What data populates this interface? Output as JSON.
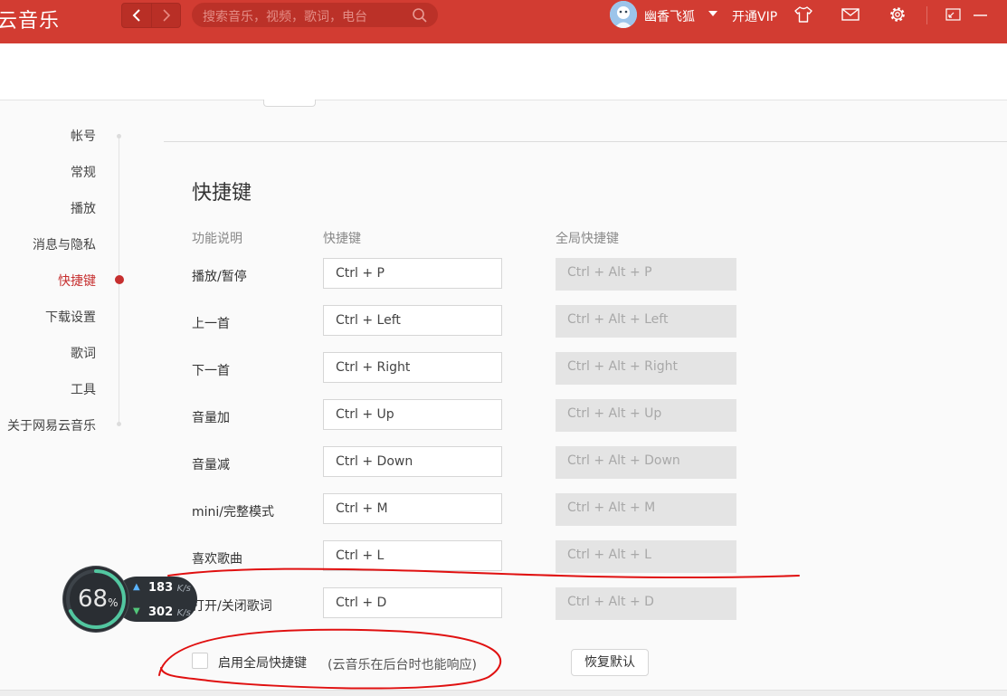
{
  "app": {
    "title": "云音乐"
  },
  "search": {
    "placeholder": "搜索音乐，视频，歌词，电台"
  },
  "user": {
    "name": "幽香飞狐",
    "vip_label": "开通VIP"
  },
  "sidebar": {
    "items": [
      {
        "label": "帐号"
      },
      {
        "label": "常规"
      },
      {
        "label": "播放"
      },
      {
        "label": "消息与隐私"
      },
      {
        "label": "快捷键",
        "active": true
      },
      {
        "label": "下载设置"
      },
      {
        "label": "歌词"
      },
      {
        "label": "工具"
      },
      {
        "label": "关于网易云音乐"
      }
    ]
  },
  "shortcuts": {
    "title": "快捷键",
    "headers": {
      "function": "功能说明",
      "hotkey": "快捷键",
      "global": "全局快捷键"
    },
    "rows": [
      {
        "label": "播放/暂停",
        "key": "Ctrl + P",
        "global": "Ctrl + Alt + P"
      },
      {
        "label": "上一首",
        "key": "Ctrl + Left",
        "global": "Ctrl + Alt + Left"
      },
      {
        "label": "下一首",
        "key": "Ctrl + Right",
        "global": "Ctrl + Alt + Right"
      },
      {
        "label": "音量加",
        "key": "Ctrl + Up",
        "global": "Ctrl + Alt + Up"
      },
      {
        "label": "音量减",
        "key": "Ctrl + Down",
        "global": "Ctrl + Alt + Down"
      },
      {
        "label": "mini/完整模式",
        "key": "Ctrl + M",
        "global": "Ctrl + Alt + M"
      },
      {
        "label": "喜欢歌曲",
        "key": "Ctrl + L",
        "global": "Ctrl + Alt + L"
      },
      {
        "label": "打开/关闭歌词",
        "key": "Ctrl + D",
        "global": "Ctrl + Alt + D"
      }
    ],
    "enable_global_label": "启用全局快捷键",
    "enable_global_hint": "(云音乐在后台时也能响应)",
    "enable_global_checked": false,
    "reset_label": "恢复默认"
  },
  "monitor_widget": {
    "percent": "68",
    "percent_sign": "%",
    "upload": "183",
    "download": "302",
    "unit": "K/s"
  },
  "colors": {
    "brand": "#d23c32",
    "accent": "#c62f2f",
    "annotation": "#e01010"
  }
}
